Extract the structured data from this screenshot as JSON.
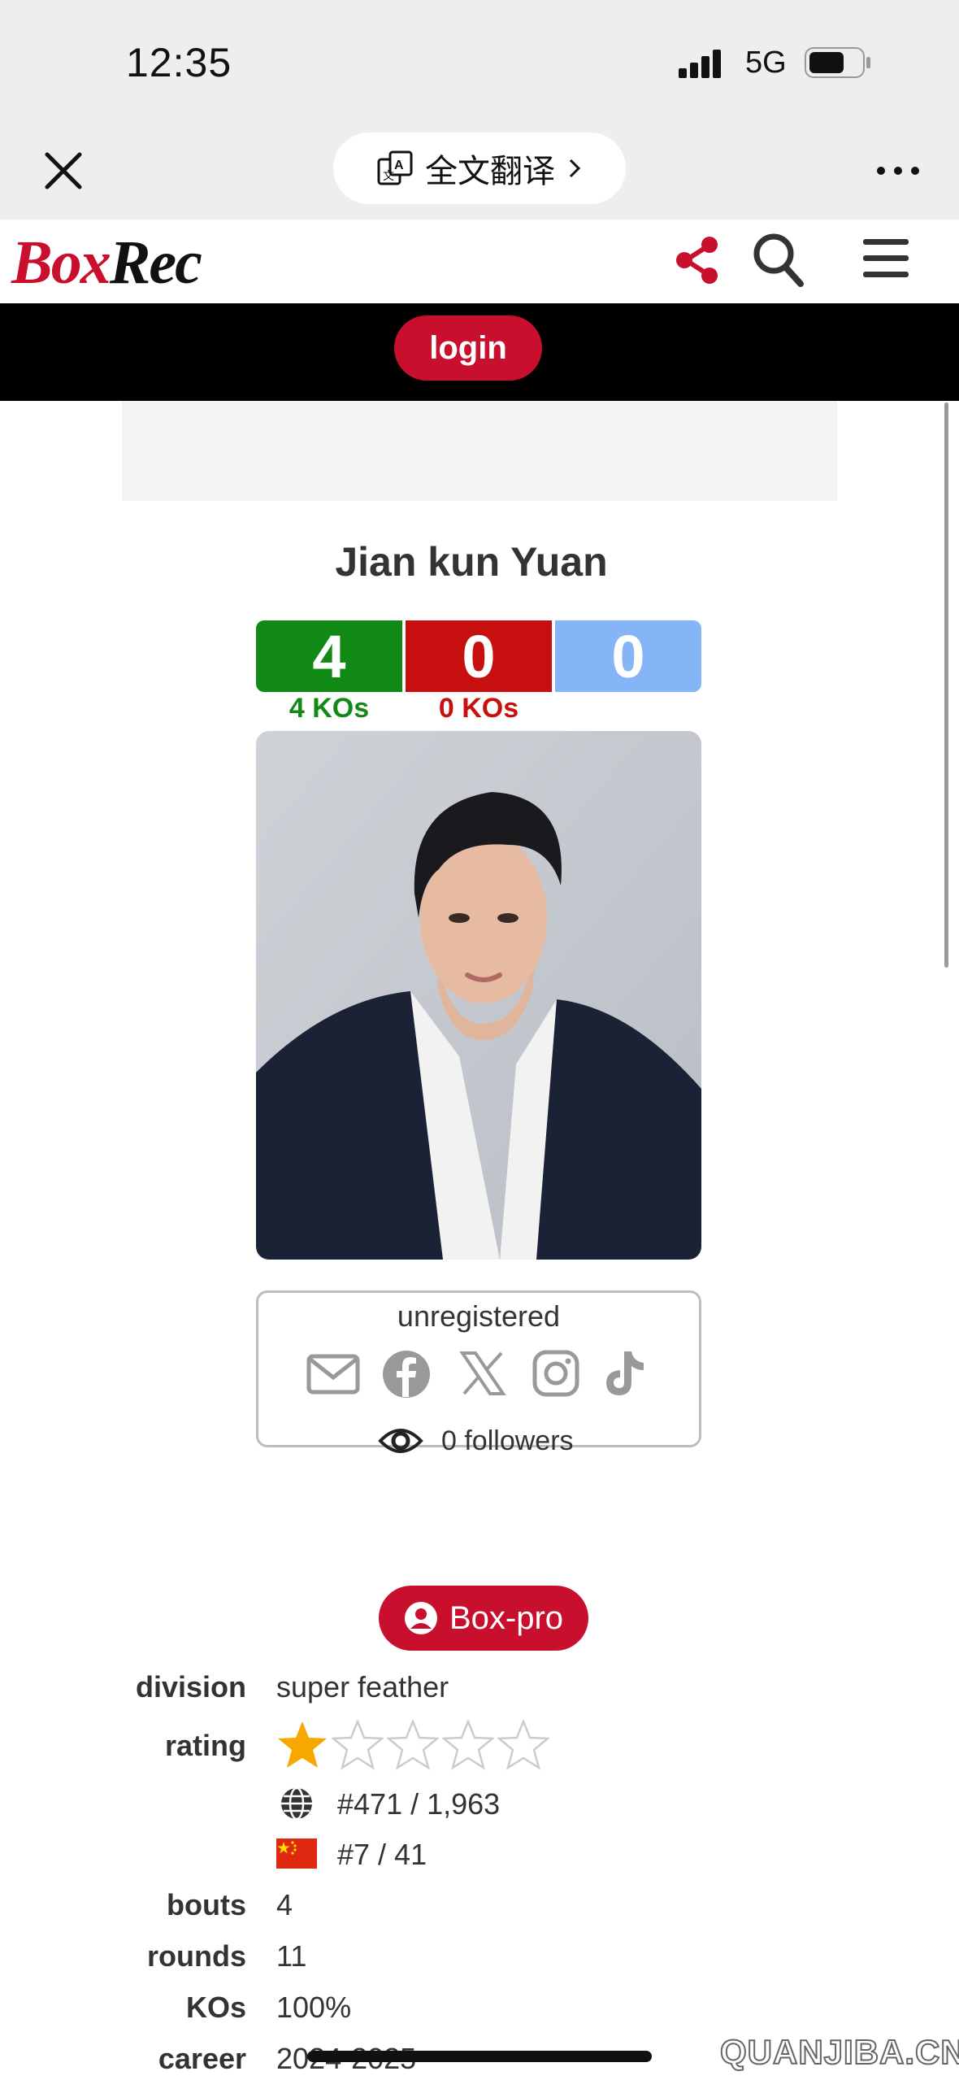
{
  "status": {
    "time": "12:35",
    "network": "5G"
  },
  "browser": {
    "translate_label": "全文翻译"
  },
  "site": {
    "logo_box": "Box",
    "logo_rec": "Rec",
    "login_label": "login"
  },
  "profile": {
    "name": "Jian kun Yuan",
    "wins": "4",
    "losses": "0",
    "draws": "0",
    "win_kos": "4 KOs",
    "loss_kos": "0 KOs",
    "status": "unregistered",
    "followers": "0 followers",
    "boxpro_label": "Box-pro"
  },
  "details": {
    "division_label": "division",
    "division_value": "super feather",
    "rating_label": "rating",
    "rating_stars": 1,
    "rating_max": 5,
    "world_rank": "#471 / 1,963",
    "country_rank": "#7 / 41",
    "bouts_label": "bouts",
    "bouts_value": "4",
    "rounds_label": "rounds",
    "rounds_value": "11",
    "kos_label": "KOs",
    "kos_value": "100%",
    "career_label": "career",
    "career_value": "2024-2025"
  },
  "watermark": "QUANJIBA.CN",
  "colors": {
    "brand_red": "#c8102e",
    "win_green": "#108a14",
    "loss_red": "#c80f0f",
    "draw_blue": "#85b4f7"
  }
}
